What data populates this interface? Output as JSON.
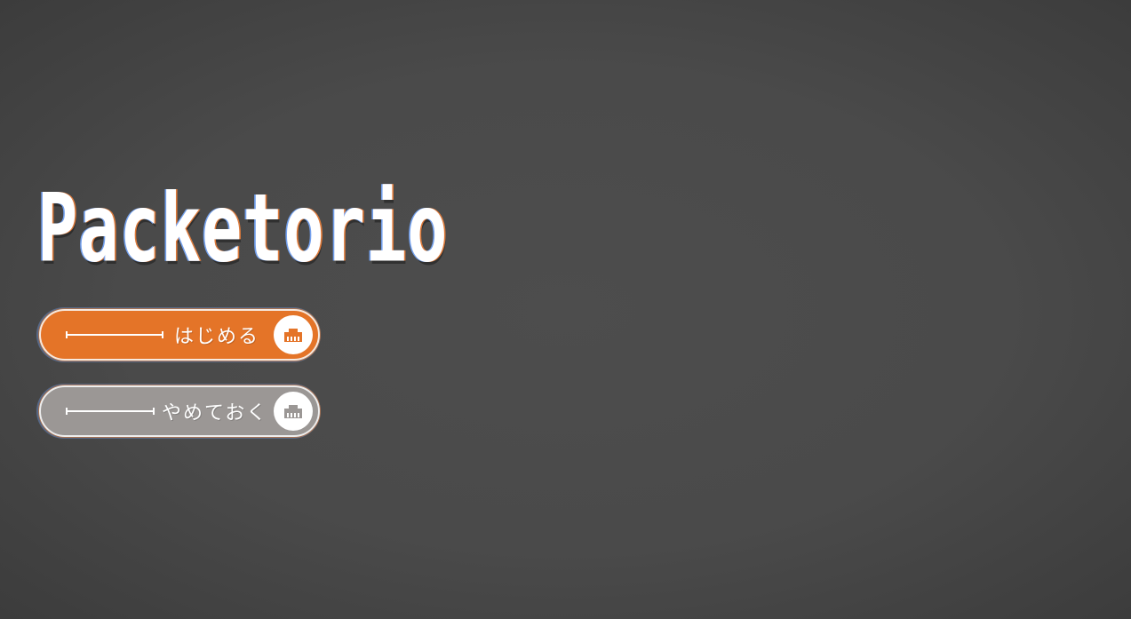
{
  "title": "Packetorio",
  "menu": {
    "start": {
      "label": "はじめる",
      "icon": "ethernet-port-icon",
      "color": "#e47428"
    },
    "quit": {
      "label": "やめておく",
      "icon": "ethernet-port-icon",
      "color": "#9b9795"
    }
  },
  "colors": {
    "background": "#4a4a4a",
    "title_text": "#ffffff"
  }
}
